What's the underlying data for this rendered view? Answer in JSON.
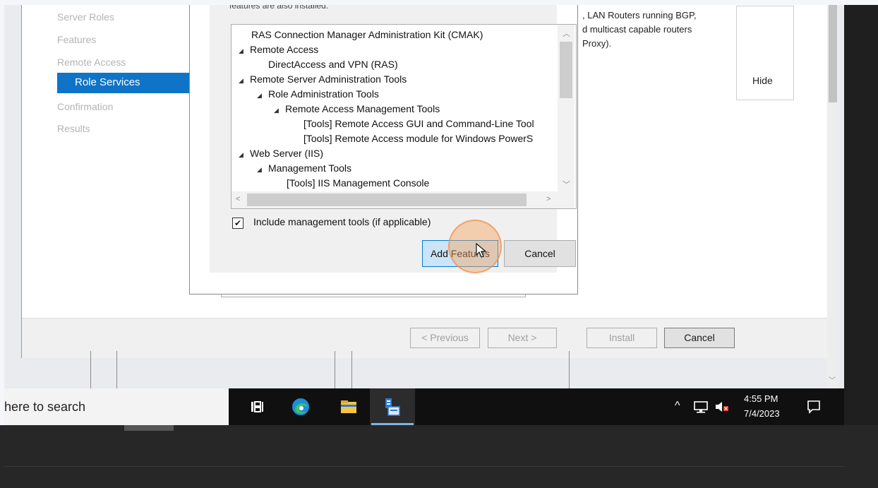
{
  "wizard": {
    "nav": [
      "Server Roles",
      "Features",
      "Remote Access",
      "Role Services",
      "Confirmation",
      "Results"
    ],
    "selected_nav": "Role Services",
    "description_lines": [
      ", LAN Routers running BGP,",
      "d multicast capable routers",
      "Proxy)."
    ],
    "hide_label": "Hide",
    "footer": {
      "previous": "< Previous",
      "next": "Next >",
      "install": "Install",
      "cancel": "Cancel"
    }
  },
  "dialog": {
    "top_text": "features are also installed.",
    "tree": [
      {
        "text": "RAS Connection Manager Administration Kit (CMAK)",
        "level": 0,
        "expand": false
      },
      {
        "text": "Remote Access",
        "level": 0,
        "expand": true
      },
      {
        "text": "DirectAccess and VPN (RAS)",
        "level": 1,
        "expand": false
      },
      {
        "text": "Remote Server Administration Tools",
        "level": 0,
        "expand": true
      },
      {
        "text": "Role Administration Tools",
        "level": 1,
        "expand": true
      },
      {
        "text": "Remote Access Management Tools",
        "level": 2,
        "expand": true
      },
      {
        "text": "[Tools] Remote Access GUI and Command-Line Tool",
        "level": 3,
        "expand": false
      },
      {
        "text": "[Tools] Remote Access module for Windows PowerS",
        "level": 3,
        "expand": false
      },
      {
        "text": "Web Server (IIS)",
        "level": 0,
        "expand": true
      },
      {
        "text": "Management Tools",
        "level": 1,
        "expand": true
      },
      {
        "text": "[Tools] IIS Management Console",
        "level": 2,
        "expand": false
      }
    ],
    "include_tools_label": "Include management tools (if applicable)",
    "include_tools_checked": true,
    "add_features_label": "Add Features",
    "cancel_label": "Cancel"
  },
  "taskbar": {
    "search_text": "here to search",
    "apps": [
      "task-view-icon",
      "edge-icon",
      "file-explorer-icon",
      "server-manager-icon"
    ],
    "time": "4:55 PM",
    "date": "7/4/2023",
    "tray_chevron": "^"
  },
  "colors": {
    "selection": "#0f74c8",
    "accent_button": "#cce4f7",
    "click_highlight": "#f4a460"
  }
}
